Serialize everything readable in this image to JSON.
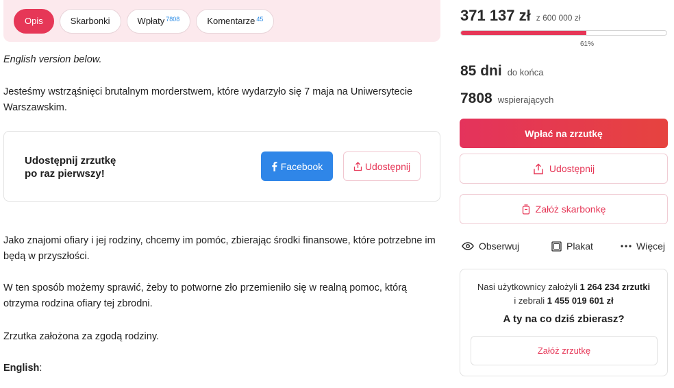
{
  "tabs": [
    {
      "label": "Opis",
      "count": ""
    },
    {
      "label": "Skarbonki",
      "count": ""
    },
    {
      "label": "Wpłaty",
      "count": "7808"
    },
    {
      "label": "Komentarze",
      "count": "45"
    }
  ],
  "description": {
    "english_note": "English version below.",
    "p1": "Jesteśmy wstrząśnięci brutalnym morderstwem, które wydarzyło się 7 maja na Uniwersytecie Warszawskim.",
    "p2": "Jako znajomi ofiary i jej rodziny, chcemy im pomóc, zbierając środki finansowe, które potrzebne im będą w przyszłości.",
    "p3": "W ten sposób możemy sprawić, żeby to potworne zło przemieniło się w realną pomoc, którą otrzyma rodzina ofiary tej zbrodni.",
    "p4": "Zrzutka założona za zgodą rodziny.",
    "english_label": "English",
    "english_colon": ":"
  },
  "share_card": {
    "title_line1": "Udostępnij zrzutkę",
    "title_line2": "po raz pierwszy!",
    "facebook_label": "Facebook",
    "share_label": "Udostępnij"
  },
  "sidebar": {
    "amount": "371 137 zł",
    "goal": "z 600 000 zł",
    "progress_fraction": 0.61,
    "percent_label": "61%",
    "days_value": "85 dni",
    "days_label": "do końca",
    "supporters_value": "7808",
    "supporters_label": "wspierających",
    "cta_label": "Wpłać na zrzutkę",
    "share_label": "Udostępnij",
    "piggybank_label": "Załóż skarbonkę",
    "actions": {
      "observe": "Obserwuj",
      "poster": "Plakat",
      "more": "Więcej"
    },
    "promo": {
      "line1_prefix": "Nasi użytkownicy założyli ",
      "line1_value": "1 264 234 zrzutki",
      "line2_prefix": "i zebrali ",
      "line2_value": "1 455 019 601 zł",
      "question": "A ty na co dziś zbierasz?",
      "button": "Załóż zrzutkę"
    }
  },
  "colors": {
    "accent": "#e63757",
    "facebook": "#2f86e8",
    "tab_bar_bg": "#fce9ed",
    "count_badge": "#2b8ce6"
  },
  "icons": [
    "facebook-icon",
    "share-icon",
    "piggybank-icon",
    "eye-icon",
    "poster-icon",
    "more-dots-icon"
  ]
}
